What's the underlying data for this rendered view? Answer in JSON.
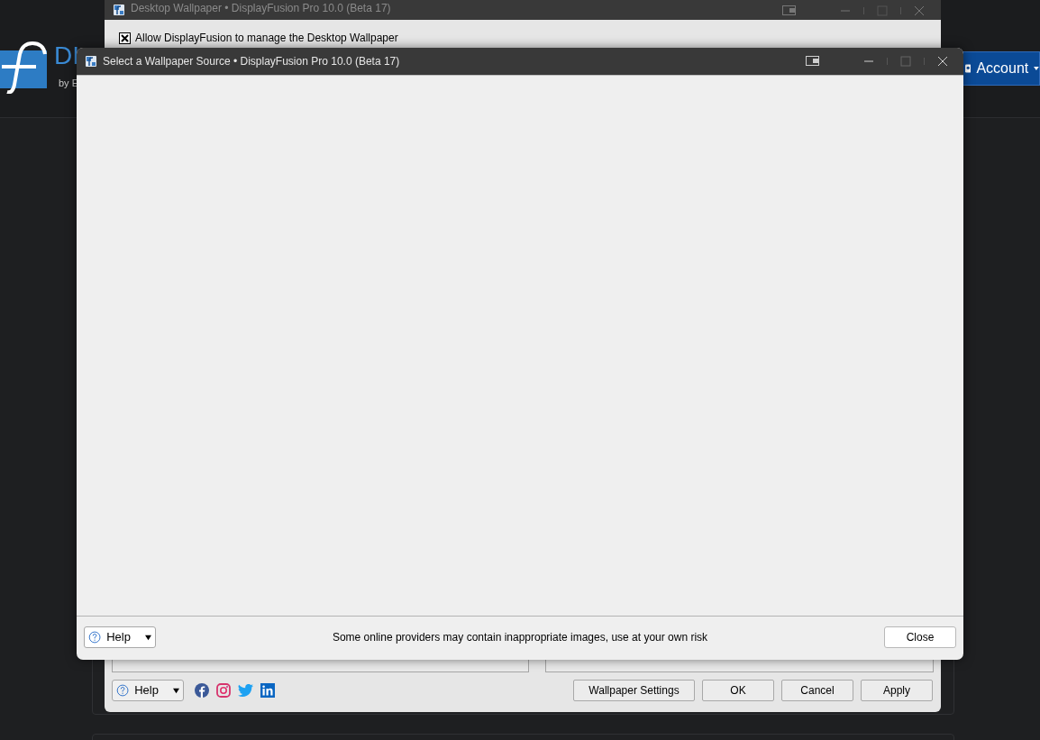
{
  "website": {
    "logo_text": "DI",
    "logo_subtext": "by E",
    "account_button": "Account"
  },
  "back_window": {
    "title": "Desktop Wallpaper • DisplayFusion Pro 10.0 (Beta 17)",
    "active": false,
    "checkbox": {
      "label": "Allow DisplayFusion to manage the Desktop Wallpaper",
      "checked": true
    },
    "help_button": "Help",
    "social_links": [
      {
        "kind": "facebook"
      },
      {
        "kind": "instagram"
      },
      {
        "kind": "twitter"
      },
      {
        "kind": "linkedin"
      }
    ],
    "buttons": [
      "Wallpaper Settings",
      "OK",
      "Cancel",
      "Apply"
    ]
  },
  "front_window": {
    "title": "Select a Wallpaper Source • DisplayFusion Pro 10.0 (Beta 17)",
    "active": true,
    "help_button": "Help",
    "notice": "Some online providers may contain inappropriate images, use at your own risk",
    "close_button": "Close"
  }
}
